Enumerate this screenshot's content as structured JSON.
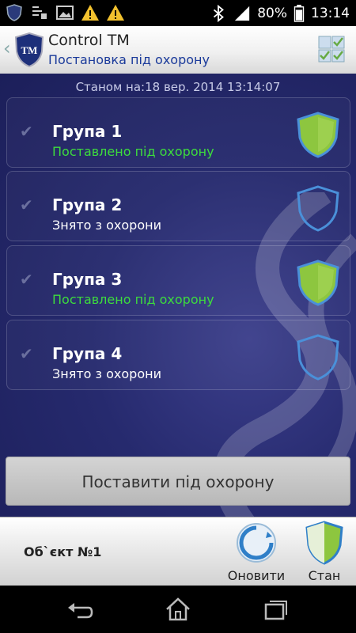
{
  "status_bar": {
    "battery": "80%",
    "time": "13:14",
    "left_icons": [
      "app-shield-icon",
      "list-notification-icon",
      "image-icon",
      "warning-icon",
      "warning-icon"
    ],
    "right_icons": [
      "bluetooth-icon",
      "signal-icon",
      "battery-icon"
    ]
  },
  "app_bar": {
    "title": "Control TM",
    "subtitle": "Постановка під охорону",
    "logo_text": "TM"
  },
  "timestamp": "Станом на:18 вер. 2014 13:14:07",
  "groups": [
    {
      "name": "Група 1",
      "status": "Поставлено під охорону",
      "armed": true
    },
    {
      "name": "Група 2",
      "status": "Знято з охорони",
      "armed": false
    },
    {
      "name": "Група 3",
      "status": "Поставлено під охорону",
      "armed": true
    },
    {
      "name": "Група 4",
      "status": "Знято з охорони",
      "armed": false
    }
  ],
  "arm_button": "Поставити під охорону",
  "bottom_bar": {
    "object_name": "Об`єкт №1",
    "refresh_label": "Оновити",
    "status_label": "Стан"
  },
  "colors": {
    "armed_status": "#3ddc3d",
    "disarmed_status": "#ffffff",
    "shield_armed_fill": "#8dc63f",
    "shield_border": "#4a90d9",
    "background": "#262a6e"
  }
}
